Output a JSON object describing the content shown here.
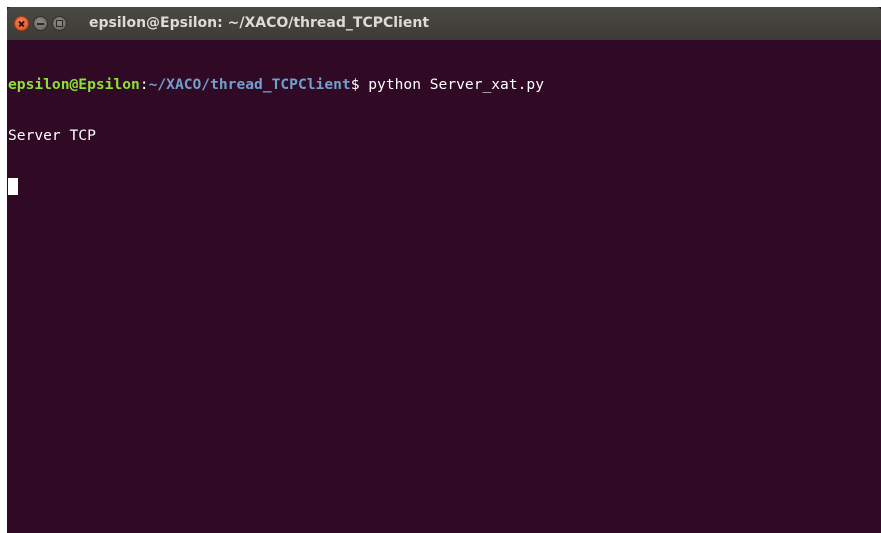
{
  "window": {
    "title": "epsilon@Epsilon: ~/XACO/thread_TCPClient",
    "controls": {
      "close_icon": "close-icon",
      "minimize_icon": "minimize-icon",
      "maximize_icon": "maximize-icon"
    }
  },
  "terminal": {
    "prompt_user": "epsilon@Epsilon",
    "prompt_sep": ":",
    "prompt_path": "~/XACO/thread_TCPClient",
    "prompt_symbol": "$ ",
    "command": "python Server_xat.py",
    "output": [
      "Server TCP"
    ]
  },
  "colors": {
    "background": "#300a24",
    "user": "#8ae234",
    "path": "#729fcf",
    "text": "#ffffff"
  }
}
